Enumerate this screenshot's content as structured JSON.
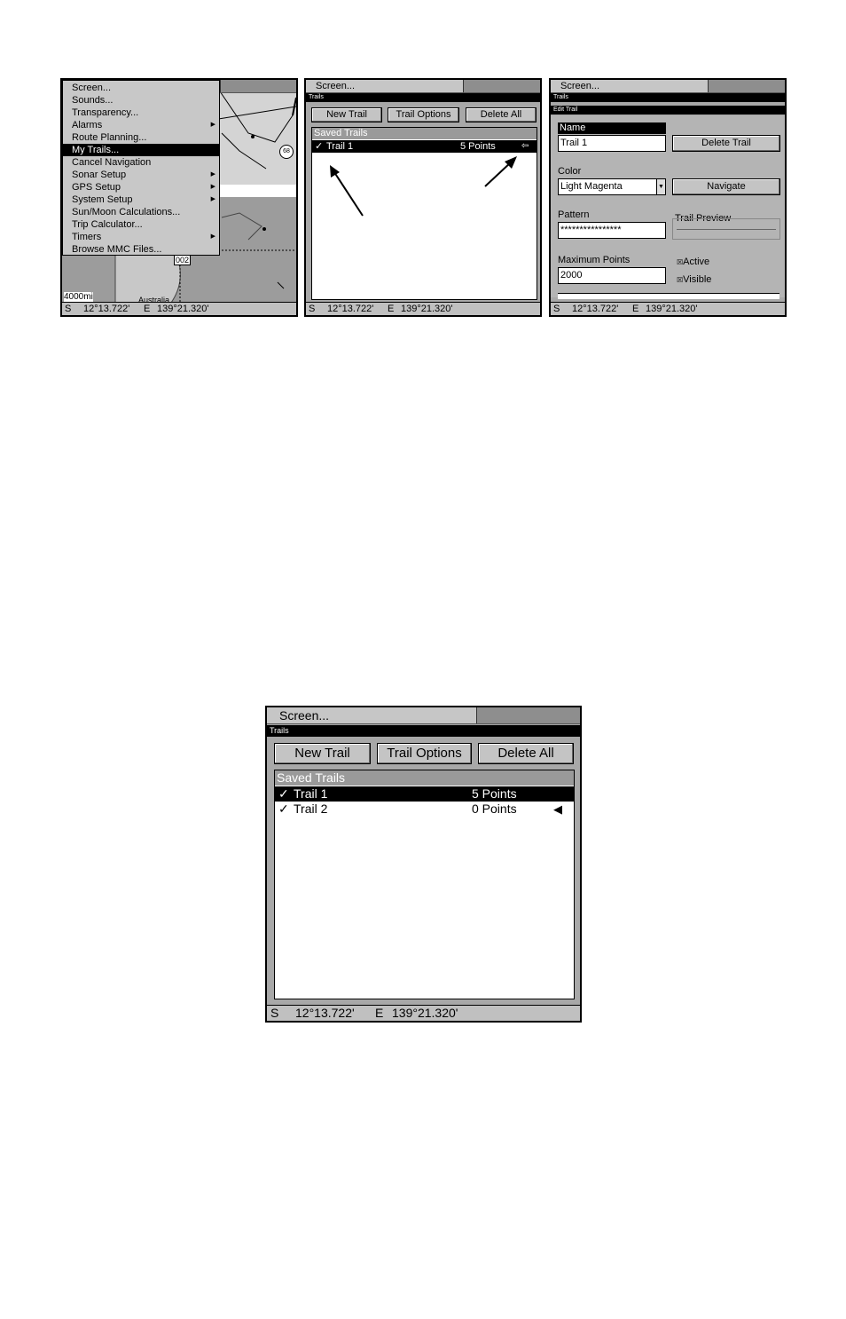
{
  "panel1": {
    "menu_items": [
      {
        "label": "Screen...",
        "submenu": false
      },
      {
        "label": "Sounds...",
        "submenu": false
      },
      {
        "label": "Transparency...",
        "submenu": false
      },
      {
        "label": "Alarms",
        "submenu": true
      },
      {
        "label": "Route Planning...",
        "submenu": false
      },
      {
        "label": "My Trails...",
        "submenu": false,
        "highlighted": true
      },
      {
        "label": "Cancel Navigation",
        "submenu": false
      },
      {
        "label": "Sonar Setup",
        "submenu": true
      },
      {
        "label": "GPS Setup",
        "submenu": true
      },
      {
        "label": "System Setup",
        "submenu": true
      },
      {
        "label": "Sun/Moon Calculations...",
        "submenu": false
      },
      {
        "label": "Trip Calculator...",
        "submenu": false
      },
      {
        "label": "Timers",
        "submenu": true
      },
      {
        "label": "Browse MMC Files...",
        "submenu": false
      }
    ],
    "scale_label": "4000mi",
    "map_label": "Australia",
    "waypoint_label": "002",
    "shield_label": "68"
  },
  "panel2": {
    "titlebar": "Screen...",
    "window_title": "Trails",
    "buttons": [
      "New Trail",
      "Trail Options",
      "Delete All"
    ],
    "list_header": "Saved Trails",
    "trails": [
      {
        "check": "✓",
        "name": "Trail 1",
        "points": "5 Points",
        "selected": true
      }
    ]
  },
  "panel3": {
    "titlebar": "Screen...",
    "window_title": "Trails",
    "dialog_title": "Edit Trail",
    "name_label": "Name",
    "name_value": "Trail 1",
    "delete_button": "Delete Trail",
    "color_label": "Color",
    "color_value": "Light Magenta",
    "navigate_button": "Navigate",
    "pattern_label": "Pattern",
    "pattern_value": "****************",
    "trail_preview_label": "Trail Preview",
    "max_points_label": "Maximum Points",
    "max_points_value": "2000",
    "active_label": "Active",
    "visible_label": "Visible",
    "active_checked": true,
    "visible_checked": true
  },
  "panel4": {
    "titlebar": "Screen...",
    "window_title": "Trails",
    "buttons": [
      "New Trail",
      "Trail Options",
      "Delete All"
    ],
    "list_header": "Saved Trails",
    "trails": [
      {
        "check": "✓",
        "name": "Trail 1",
        "points": "5 Points",
        "selected": true
      },
      {
        "check": "✓",
        "name": "Trail 2",
        "points": "0 Points",
        "selected": false
      }
    ]
  },
  "status": {
    "lat_hemi": "S",
    "lat": "12°13.722'",
    "lon_hemi": "E",
    "lon": "139°21.320'"
  },
  "colors": {
    "highlight": "#000000",
    "panel_bg": "#a8a8a8",
    "list_bg": "#ffffff",
    "header_gray": "#9a9a9a"
  }
}
